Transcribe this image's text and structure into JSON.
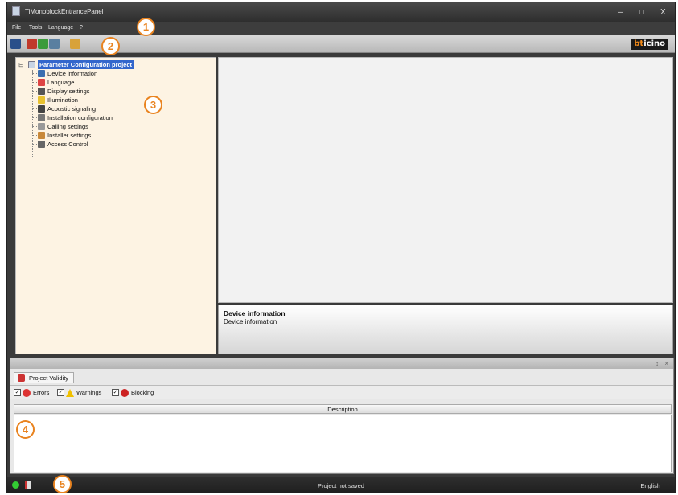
{
  "window": {
    "title": "TiMonoblockEntrancePanel"
  },
  "window_controls": {
    "minimize": "–",
    "maximize": "□",
    "close": "X"
  },
  "menu": [
    {
      "label": "File"
    },
    {
      "label": "Tools"
    },
    {
      "label": "Language"
    },
    {
      "label": "?"
    }
  ],
  "toolbar": {
    "buttons": [
      {
        "icon": "save-icon",
        "color": "#2a4f8a"
      },
      {
        "icon": "receive-icon",
        "color": "#c0392b"
      },
      {
        "icon": "send-icon",
        "color": "#3b9b3b"
      },
      {
        "icon": "device-icon",
        "color": "#5a7fa0"
      },
      {
        "icon": "chip-icon",
        "color": "#d8a23a"
      }
    ],
    "brand_prefix": "bt",
    "brand_suffix": "icino"
  },
  "tree": {
    "root": "Parameter Configuration project",
    "items": [
      {
        "label": "Device information",
        "icon": "info-icon",
        "color": "#3c6fb0"
      },
      {
        "label": "Language",
        "icon": "flags-icon",
        "color": "#d44"
      },
      {
        "label": "Display settings",
        "icon": "display-icon",
        "color": "#555"
      },
      {
        "label": "Illumination",
        "icon": "lightbulb-icon",
        "color": "#e8c230"
      },
      {
        "label": "Acoustic signaling",
        "icon": "speaker-icon",
        "color": "#444"
      },
      {
        "label": "Installation configuration",
        "icon": "document-icon",
        "color": "#777"
      },
      {
        "label": "Calling settings",
        "icon": "call-icon",
        "color": "#999"
      },
      {
        "label": "Installer settings",
        "icon": "installer-icon",
        "color": "#c8883a"
      },
      {
        "label": "Access Control",
        "icon": "access-icon",
        "color": "#666"
      }
    ]
  },
  "description": {
    "title": "Device information",
    "text": "Device information"
  },
  "bottom_panel": {
    "pin": "↕",
    "close": "×",
    "tab": "Project Validity",
    "filters": [
      {
        "label": "Errors",
        "checked": "✓",
        "color": "#d33",
        "icon": "error-icon"
      },
      {
        "label": "Warnings",
        "checked": "✓",
        "color": "#f0c000",
        "icon": "warning-icon"
      },
      {
        "label": "Blocking",
        "checked": "✓",
        "color": "#c22",
        "icon": "blocking-icon"
      }
    ],
    "column": "Description"
  },
  "status": {
    "text": "Project not saved",
    "language": "English"
  },
  "callouts": [
    "1",
    "2",
    "3",
    "4",
    "5"
  ]
}
